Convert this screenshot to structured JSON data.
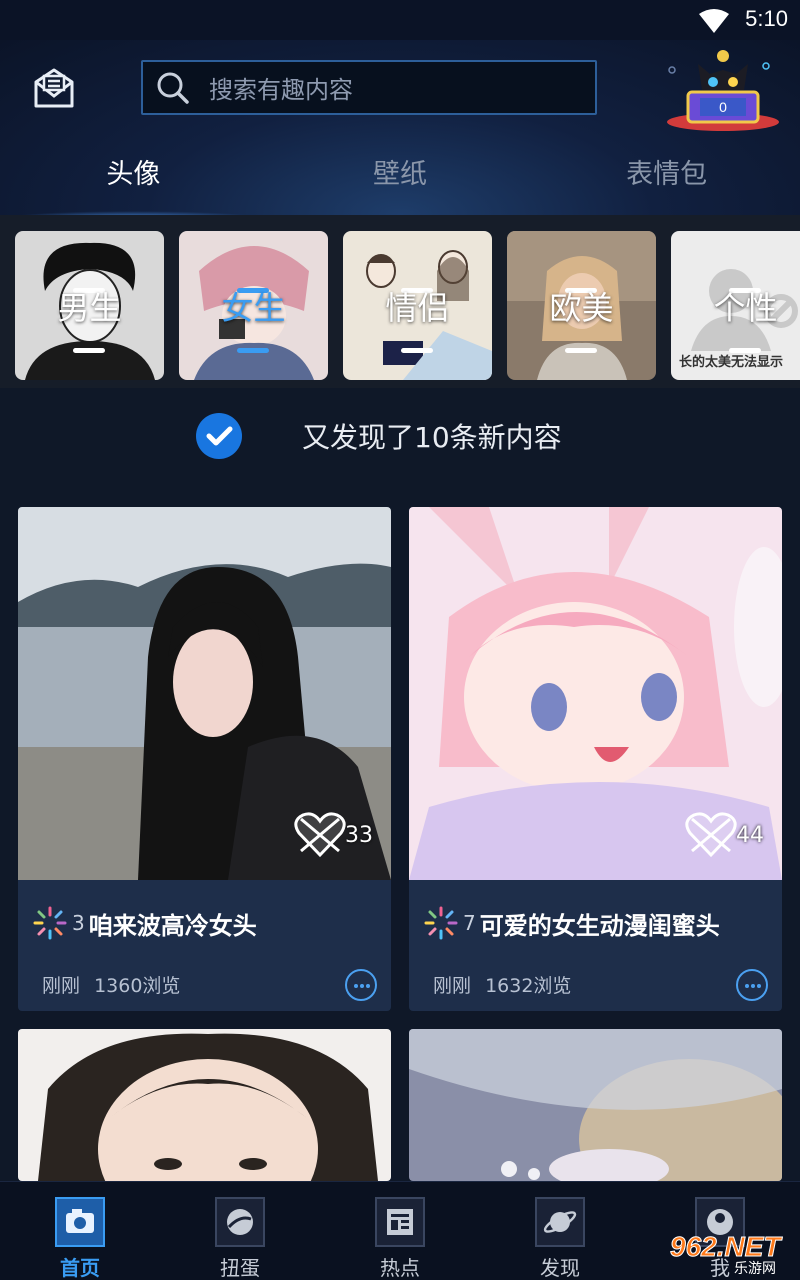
{
  "status_bar": {
    "time": "5:10",
    "wifi_icon": "wifi-icon"
  },
  "header": {
    "mail_icon": "mail-icon",
    "search": {
      "placeholder": "搜索有趣内容",
      "icon": "search-icon"
    },
    "mascot": {
      "icon": "cat-mascot-icon",
      "count": "0"
    },
    "tabs": [
      {
        "label": "头像",
        "active": true
      },
      {
        "label": "壁纸",
        "active": false
      },
      {
        "label": "表情包",
        "active": false
      }
    ]
  },
  "categories": [
    {
      "label": "男生",
      "active": false,
      "caption": ""
    },
    {
      "label": "女生",
      "active": true,
      "caption": ""
    },
    {
      "label": "情侣",
      "active": false,
      "caption": ""
    },
    {
      "label": "欧美",
      "active": false,
      "caption": ""
    },
    {
      "label": "个性",
      "active": false,
      "caption": "长的太美无法显示"
    }
  ],
  "notice": {
    "text": "又发现了10条新内容",
    "icon": "check-circle-icon"
  },
  "cards": [
    {
      "rank": "3",
      "title": "咱来波高冷女头",
      "time": "刚刚",
      "views": "1360浏览",
      "likes": "33"
    },
    {
      "rank": "7",
      "title": "可爱的女生动漫闺蜜头",
      "time": "刚刚",
      "views": "1632浏览",
      "likes": "44"
    },
    {
      "rank": "",
      "title": "",
      "time": "",
      "views": "",
      "likes": ""
    },
    {
      "rank": "",
      "title": "",
      "time": "",
      "views": "",
      "likes": ""
    }
  ],
  "bottom_nav": [
    {
      "label": "首页",
      "icon": "camera-icon",
      "active": true
    },
    {
      "label": "扭蛋",
      "icon": "gacha-icon",
      "active": false
    },
    {
      "label": "热点",
      "icon": "news-icon",
      "active": false
    },
    {
      "label": "发现",
      "icon": "planet-icon",
      "active": false
    },
    {
      "label": "我",
      "icon": "profile-icon",
      "active": false
    }
  ],
  "watermark": {
    "brand": "962.NET",
    "sub": "乐游网"
  },
  "colors": {
    "accent": "#3a9cf2",
    "background": "#0f1828",
    "card": "#1e2e4a"
  }
}
